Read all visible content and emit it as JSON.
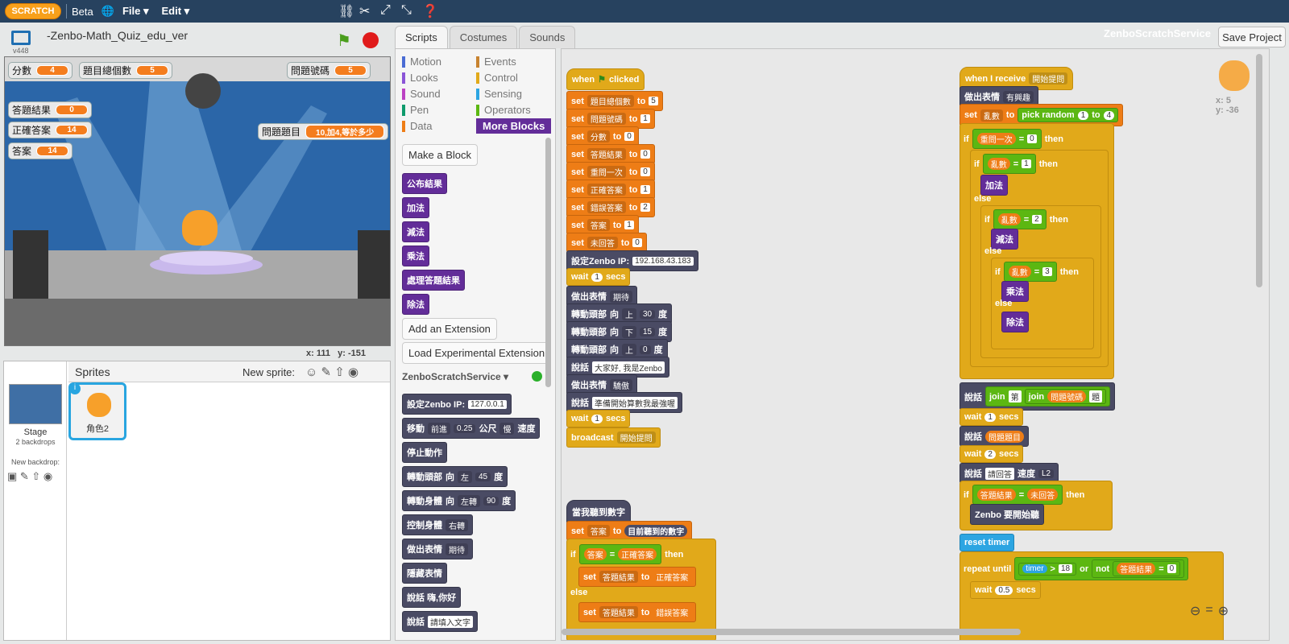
{
  "topbar": {
    "logo": "SCRATCH",
    "beta": "Beta",
    "file": "File ▾",
    "edit": "Edit ▾"
  },
  "project": {
    "title": "-Zenbo-Math_Quiz_edu_ver",
    "version": "v448"
  },
  "monitors": [
    {
      "label": "分數",
      "value": "4"
    },
    {
      "label": "題目總個數",
      "value": "5"
    },
    {
      "label": "問題號碼",
      "value": "5"
    },
    {
      "label": "答題結果",
      "value": "0"
    },
    {
      "label": "正確答案",
      "value": "14"
    },
    {
      "label": "答案",
      "value": "14"
    },
    {
      "label": "問題題目",
      "value": "10,加4,等於多少"
    }
  ],
  "stage_coords": {
    "x_label": "x:",
    "x": "111",
    "y_label": "y:",
    "y": "-151"
  },
  "sprites": {
    "header": "Sprites",
    "new_sprite": "New sprite:",
    "stage_label": "Stage",
    "backdrops": "2 backdrops",
    "new_backdrop": "New backdrop:",
    "sprite_name": "角色2"
  },
  "tabs": [
    "Scripts",
    "Costumes",
    "Sounds"
  ],
  "categories": {
    "left": [
      "Motion",
      "Looks",
      "Sound",
      "Pen",
      "Data"
    ],
    "right": [
      "Events",
      "Control",
      "Sensing",
      "Operators",
      "More Blocks"
    ]
  },
  "palette": {
    "make_block": "Make a Block",
    "custom_blocks": [
      "公布結果",
      "加法",
      "減法",
      "乘法",
      "處理答題結果",
      "除法"
    ],
    "add_extension": "Add an Extension",
    "load_experimental": "Load Experimental Extension",
    "extension_name": "ZenboScratchService ▾",
    "ext_blocks": [
      "設定Zenbo IP:",
      "移動",
      "停止動作",
      "轉動頭部",
      "轉動身體",
      "控制身體",
      "做出表情",
      "隱藏表情",
      "說話 嗨,你好",
      "說話"
    ],
    "ext_ip": "127.0.0.1",
    "move_dir": "前進",
    "move_dist": "0.25",
    "move_unit": "公尺",
    "move_speed": "慢",
    "move_speed_label": "速度",
    "head_dir_label": "向",
    "head_dir": "左",
    "head_deg": "45",
    "deg": "度",
    "body_dir": "左轉",
    "body_deg": "90",
    "body_ctrl": "右轉",
    "face": "期待",
    "say_hi": "嗨,你好",
    "say_input": "請填入文字"
  },
  "header_right": {
    "service": "ZenboScratchService",
    "save": "Save Project"
  },
  "script1": {
    "hat": "when",
    "hat2": "clicked",
    "sets": [
      [
        "題目總個數",
        "5"
      ],
      [
        "問題號碼",
        "1"
      ],
      [
        "分數",
        "0"
      ],
      [
        "答題結果",
        "0"
      ],
      [
        "重問一次",
        "0"
      ],
      [
        "正確答案",
        "1"
      ],
      [
        "錯誤答案",
        "2"
      ],
      [
        "答案",
        "1"
      ],
      [
        "未回答",
        "0"
      ]
    ],
    "set_word": "set",
    "to_word": "to",
    "zenbo_ip_label": "設定Zenbo IP:",
    "zenbo_ip": "192.168.43.183",
    "wait": "wait",
    "secs": "secs",
    "wait1": "1",
    "face": "做出表情",
    "face_val": "期待",
    "head": "轉動頭部",
    "dir": "向",
    "up": "上",
    "down": "下",
    "deg": "度",
    "head1": "30",
    "head2": "15",
    "head3": "0",
    "say": "說話",
    "say1": "大家好, 我是Zenbo",
    "face2": "驕傲",
    "say2": "準備開始算數我最強喔",
    "broadcast": "broadcast",
    "bmsg": "開始提問"
  },
  "script2": {
    "hat": "當我聽到數字",
    "set_var": "答案",
    "to_val": "目前聽到的數字",
    "if_word": "if",
    "then_word": "then",
    "else_word": "else",
    "cmp_a": "答案",
    "cmp_b": "正確答案",
    "set_res": "答題結果",
    "res_ok": "正確答案",
    "res_bad": "錯誤答案"
  },
  "script3": {
    "hat": "when I receive",
    "msg": "開始提問",
    "face_val": "有興趣",
    "set_var": "亂數",
    "pick": "pick random",
    "from": "1",
    "to": "4",
    "ask_again": "重問一次",
    "zero": "0",
    "r1": "1",
    "r2": "2",
    "r3": "3",
    "ops": [
      "加法",
      "減法",
      "乘法",
      "除法"
    ],
    "join": "join",
    "di": "第",
    "qnum": "問題號碼",
    "ti": "題",
    "qtext": "問題題目",
    "wait2": "2",
    "say_please": "請回答",
    "speed": "速度",
    "speed_val": "L2",
    "res": "答題結果",
    "no_ans": "未回答",
    "zenbo_listen": "Zenbo 要開始聽",
    "reset_timer": "reset timer",
    "repeat_until": "repeat until",
    "timer": "timer",
    "gt": ">",
    "limit": "18",
    "or": "or",
    "not": "not",
    "wait_half": "0.5"
  },
  "sprite_xy": {
    "x_label": "x:",
    "x": "5",
    "y_label": "y:",
    "y": "-36"
  }
}
